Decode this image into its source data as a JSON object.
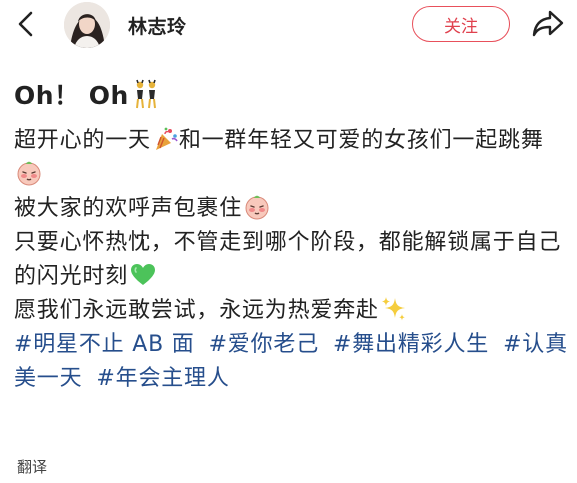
{
  "header": {
    "username": "林志玲",
    "follow_label": "关注"
  },
  "post": {
    "title_text": "Oh！ Oh",
    "lines": [
      {
        "text": "超开心的一天",
        "emoji": "party-popper-icon"
      },
      {
        "text": "和一群年轻又可爱的女孩们一起跳舞",
        "emoji": "shy-face-icon"
      },
      {
        "text": "被大家的欢呼声包裹住",
        "emoji": "shy-face-icon"
      },
      {
        "text": "只要心怀热忱，不管走到哪个阶段，都能解锁属于自己的闪光时刻",
        "emoji": "green-heart-icon"
      },
      {
        "text": "愿我们永远敢尝试，永远为热爱奔赴",
        "emoji": "sparkles-icon"
      }
    ],
    "tags": [
      "#明星不止 AB 面",
      "#爱你老己",
      "#舞出精彩人生",
      "#认真美一天",
      "#年会主理人"
    ]
  },
  "footer": {
    "translate_label": "翻译"
  },
  "colors": {
    "accent": "#e0414e",
    "tag": "#264e8c",
    "text": "#222222"
  }
}
